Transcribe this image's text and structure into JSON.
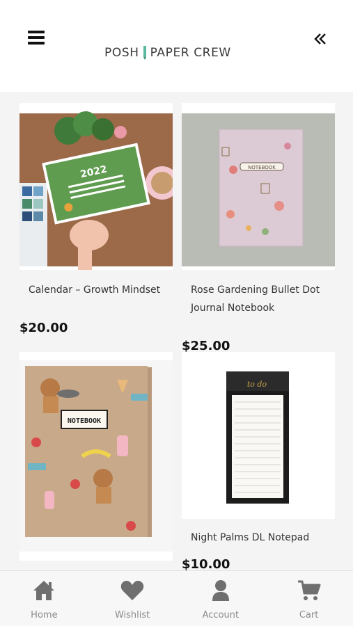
{
  "header": {
    "brand_part1": "POSH",
    "brand_part2": "PAPER CREW"
  },
  "products": [
    {
      "title": "Calendar – Growth Mindset",
      "price": "$20.00"
    },
    {
      "title_line1": "Rose Gardening Bullet Dot",
      "title_line2": "Journal Notebook",
      "price": "$25.00"
    },
    {
      "title": "",
      "price": ""
    },
    {
      "title": "Night Palms DL Notepad",
      "price": "$10.00"
    }
  ],
  "product_image_text": {
    "calendar_year": "2022",
    "notebook_label": "NOTEBOOK",
    "todo_label": "to do"
  },
  "tabs": [
    {
      "label": "Home",
      "icon": "home-icon"
    },
    {
      "label": "Wishlist",
      "icon": "heart-icon"
    },
    {
      "label": "Account",
      "icon": "user-icon"
    },
    {
      "label": "Cart",
      "icon": "cart-icon"
    }
  ],
  "colors": {
    "background": "#f4f4f4",
    "tab_icon": "#6f6f6f",
    "tab_label": "#8a8a8a",
    "logo_accent": "#5bb7a0"
  }
}
